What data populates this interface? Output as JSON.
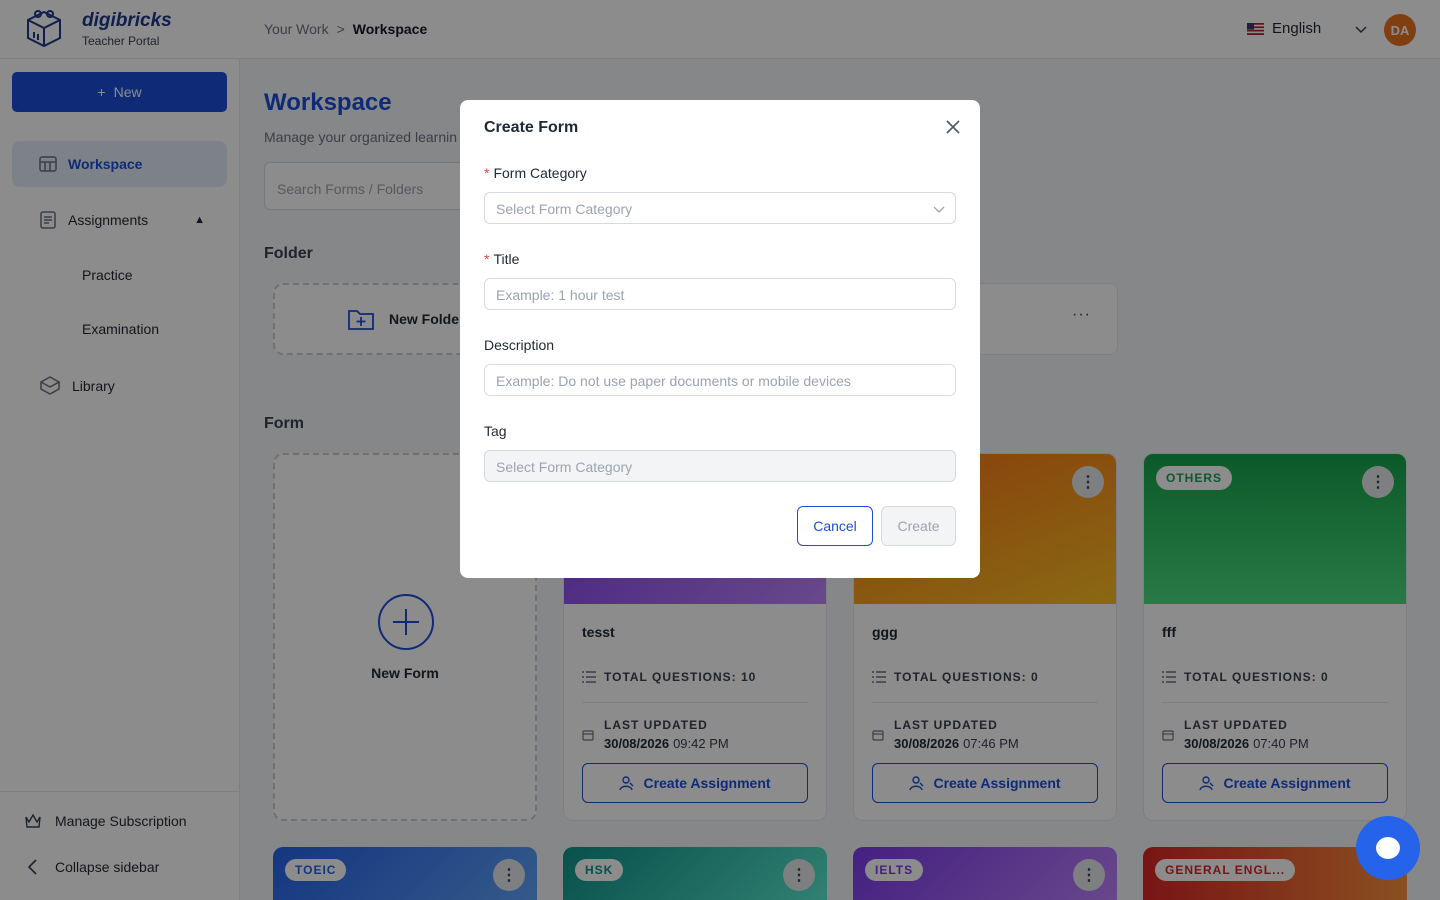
{
  "app": {
    "brand": "digibricks",
    "portal": "Teacher Portal"
  },
  "header": {
    "breadcrumb": [
      "Your Work",
      ">",
      "Workspace"
    ],
    "language": "English",
    "avatar_initials": "DA"
  },
  "sidebar": {
    "new_label": "New",
    "items": [
      {
        "label": "Workspace",
        "icon": "workspace-icon",
        "active": true
      },
      {
        "label": "Assignments",
        "icon": "assignments-icon",
        "caret": "▲"
      },
      {
        "label": "Practice"
      },
      {
        "label": "Examination"
      },
      {
        "label": "Library",
        "icon": "library-icon"
      }
    ],
    "bottom": {
      "manage_subscription": "Manage Subscription",
      "collapse": "Collapse sidebar"
    }
  },
  "main": {
    "title": "Workspace",
    "subtitle": "Manage your organized learnin",
    "search_placeholder": "Search Forms / Folders",
    "folder_section": "Folder",
    "new_folder": "New Folde",
    "folder_menu": "···",
    "form_section": "Form",
    "new_form": "New Form",
    "forms": [
      {
        "title": "tesst",
        "questions_label": "TOTAL QUESTIONS: 10",
        "updated_label": "LAST UPDATED",
        "date": "30/08/2026",
        "time": "09:42 PM",
        "button": "Create Assignment",
        "badge": ""
      },
      {
        "title": "ggg",
        "questions_label": "TOTAL QUESTIONS: 0",
        "updated_label": "LAST UPDATED",
        "date": "30/08/2026",
        "time": "07:46 PM",
        "button": "Create Assignment",
        "badge": ""
      },
      {
        "title": "fff",
        "questions_label": "TOTAL QUESTIONS: 0",
        "updated_label": "LAST UPDATED",
        "date": "30/08/2026",
        "time": "07:40 PM",
        "button": "Create Assignment",
        "badge": "OTHERS"
      }
    ],
    "row2_badges": [
      "TOEIC",
      "HSK",
      "IELTS",
      "GENERAL ENGL..."
    ],
    "kebab": "⋮"
  },
  "modal": {
    "title": "Create Form",
    "required_mark": "*",
    "category_label": "Form Category",
    "category_placeholder": "Select Form Category",
    "title_label": "Title",
    "title_placeholder": "Example: 1 hour test",
    "description_label": "Description",
    "description_placeholder": "Example: Do not use paper documents or mobile devices",
    "tag_label": "Tag",
    "tag_placeholder": "Select Form Category",
    "cancel": "Cancel",
    "create": "Create"
  },
  "colors": {
    "primary": "#1d4ed8",
    "avatar": "#e8731e",
    "others_badge": "#1f9d5a"
  }
}
